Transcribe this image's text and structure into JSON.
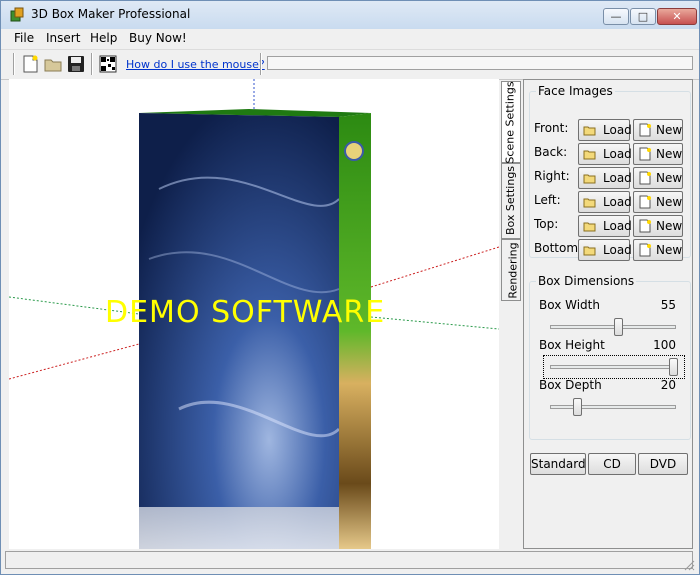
{
  "window": {
    "title": "3D Box Maker Professional"
  },
  "window_buttons": {
    "minimize": "—",
    "maximize": "□",
    "close": "✕"
  },
  "menu": {
    "items": [
      "File",
      "Insert",
      "Help",
      "Buy Now!"
    ]
  },
  "toolbar": {
    "buttons": [
      {
        "icon": "new-document-icon"
      },
      {
        "icon": "open-folder-icon"
      },
      {
        "icon": "save-disk-icon"
      },
      {
        "icon": "qr-code-icon"
      }
    ],
    "help_link": "How do I use the mouse?"
  },
  "viewport": {
    "watermark": "DEMO SOFTWARE",
    "box_front_colors": [
      "#0e1f4a",
      "#3b5fa8"
    ],
    "box_side_colors": [
      "#3f9e1f",
      "#b8902e"
    ],
    "box_top_color": "#1f7a12"
  },
  "side_tabs": [
    "Scene Settings",
    "Box Settings",
    "Rendering"
  ],
  "face_images": {
    "legend": "Face Images",
    "rows": [
      {
        "label": "Front:"
      },
      {
        "label": "Back:"
      },
      {
        "label": "Right:"
      },
      {
        "label": "Left:"
      },
      {
        "label": "Top:"
      },
      {
        "label": "Bottom:"
      }
    ],
    "load_label": "Load",
    "new_label": "New"
  },
  "box_dimensions": {
    "legend": "Box Dimensions",
    "width": {
      "label": "Box Width",
      "value": "55"
    },
    "height": {
      "label": "Box Height",
      "value": "100"
    },
    "depth": {
      "label": "Box Depth",
      "value": "20"
    }
  },
  "presets": [
    "Standard",
    "CD",
    "DVD"
  ]
}
